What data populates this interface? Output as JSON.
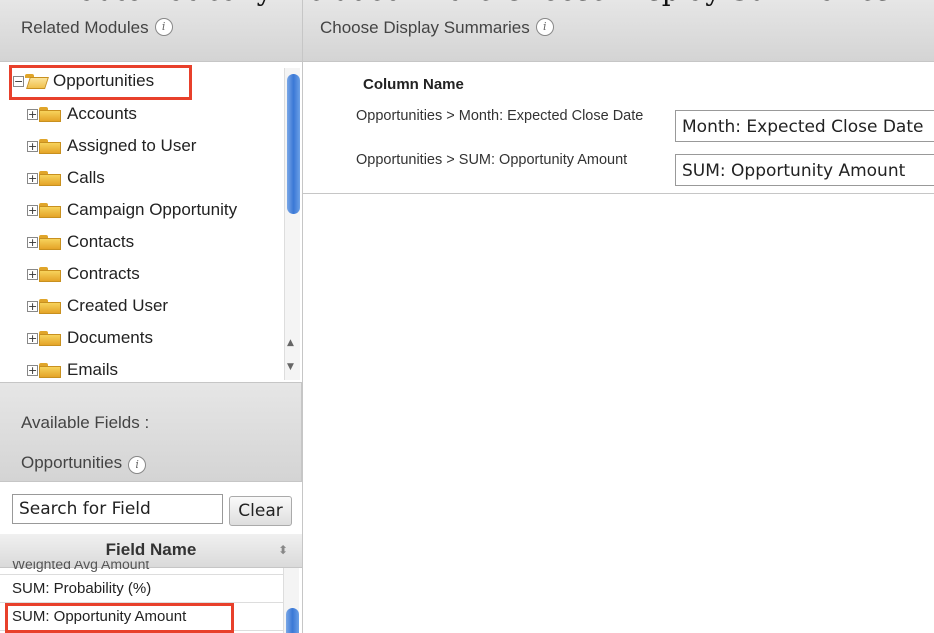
{
  "caption": "automatically included in the Choose Display Summaries",
  "related_modules": {
    "title": "Related Modules",
    "info_icon": "info-icon",
    "tree": {
      "root": "Opportunities",
      "children": [
        "Accounts",
        "Assigned to User",
        "Calls",
        "Campaign Opportunity",
        "Contacts",
        "Contracts",
        "Created User",
        "Documents",
        "Emails"
      ]
    }
  },
  "available_fields": {
    "title_line1": "Available Fields :",
    "title_line2": "Opportunities",
    "search_placeholder": "Search for Field",
    "clear_label": "Clear",
    "column_header": "Field Name",
    "rows": [
      "Weighted Avg Amount",
      "SUM: Probability (%)",
      "SUM: Opportunity Amount"
    ]
  },
  "display_summaries": {
    "title": "Choose Display Summaries",
    "column_header": "Column Name",
    "rows": [
      {
        "label": "Opportunities > Month: Expected Close Date",
        "value": "Month: Expected Close Date"
      },
      {
        "label": "Opportunities > SUM: Opportunity Amount",
        "value": "SUM: Opportunity Amount"
      }
    ]
  },
  "colors": {
    "highlight": "#e8402b",
    "scroll_thumb": "#3a78d6"
  }
}
